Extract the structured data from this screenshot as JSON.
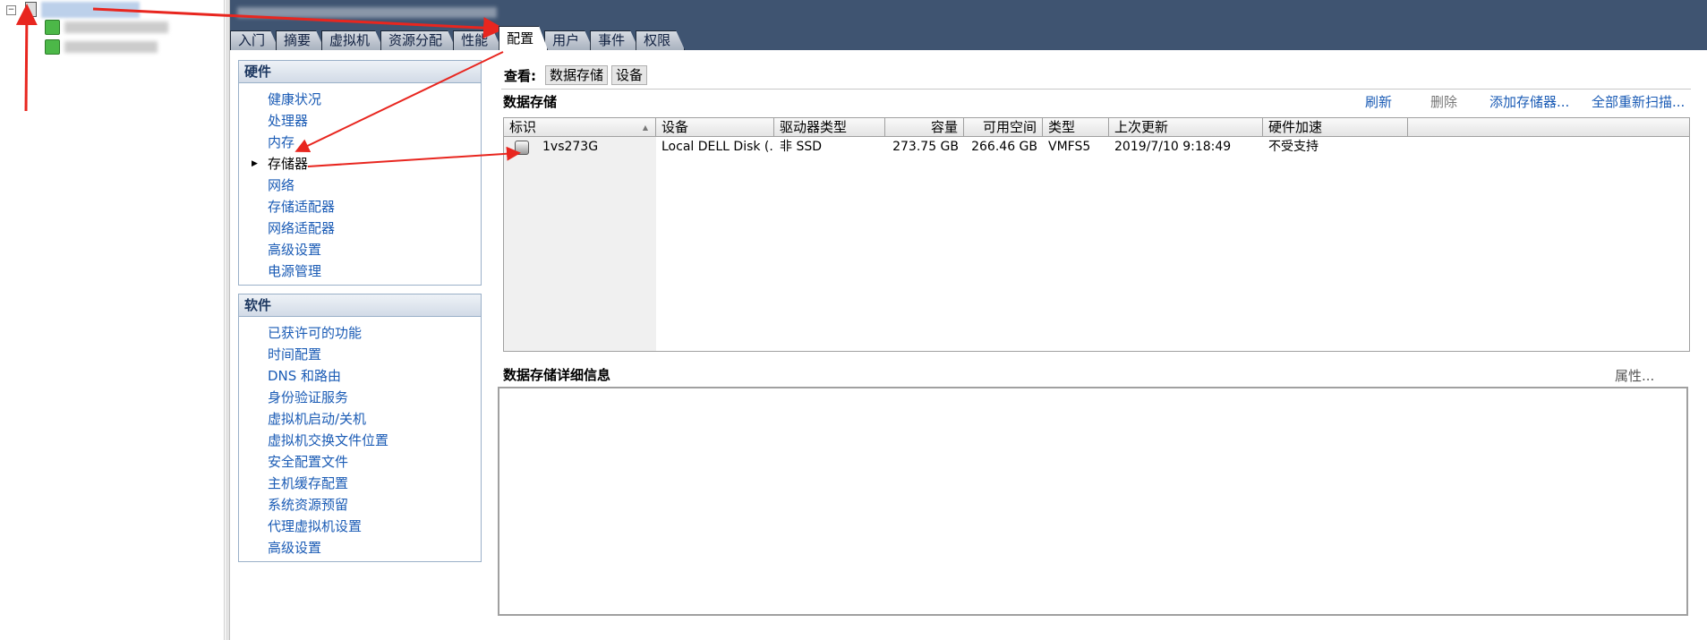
{
  "header": {
    "tabs": [
      "入门",
      "摘要",
      "虚拟机",
      "资源分配",
      "性能",
      "配置",
      "用户",
      "事件",
      "权限"
    ],
    "active_tab": "配置"
  },
  "hardware": {
    "title": "硬件",
    "items": [
      "健康状况",
      "处理器",
      "内存",
      "存储器",
      "网络",
      "存储适配器",
      "网络适配器",
      "高级设置",
      "电源管理"
    ],
    "selected": "存储器"
  },
  "software": {
    "title": "软件",
    "items": [
      "已获许可的功能",
      "时间配置",
      "DNS 和路由",
      "身份验证服务",
      "虚拟机启动/关机",
      "虚拟机交换文件位置",
      "安全配置文件",
      "主机缓存配置",
      "系统资源预留",
      "代理虚拟机设置",
      "高级设置"
    ]
  },
  "view": {
    "label": "查看:",
    "buttons": [
      "数据存储",
      "设备"
    ]
  },
  "datastores": {
    "title": "数据存储",
    "actions": {
      "refresh": "刷新",
      "delete": "删除",
      "add": "添加存储器...",
      "rescan": "全部重新扫描..."
    },
    "columns": [
      "标识",
      "设备",
      "驱动器类型",
      "容量",
      "可用空间",
      "类型",
      "上次更新",
      "硬件加速"
    ],
    "rows": [
      {
        "id": "1vs273G",
        "device": "Local DELL Disk (...",
        "drive_type": "非 SSD",
        "capacity": "273.75 GB",
        "free": "266.46 GB",
        "type": "VMFS5",
        "updated": "2019/7/10 9:18:49",
        "hw_accel": "不受支持"
      }
    ]
  },
  "details": {
    "title": "数据存储详细信息",
    "properties": "属性..."
  },
  "icons": {
    "tree_toggle": "minus-box-icon",
    "host": "server-icon",
    "vm": "vm-icon",
    "datastore": "datastore-icon"
  },
  "colors": {
    "header_bg": "#3f5471",
    "link": "#1a5bb5",
    "annotation": "#e8261f"
  }
}
